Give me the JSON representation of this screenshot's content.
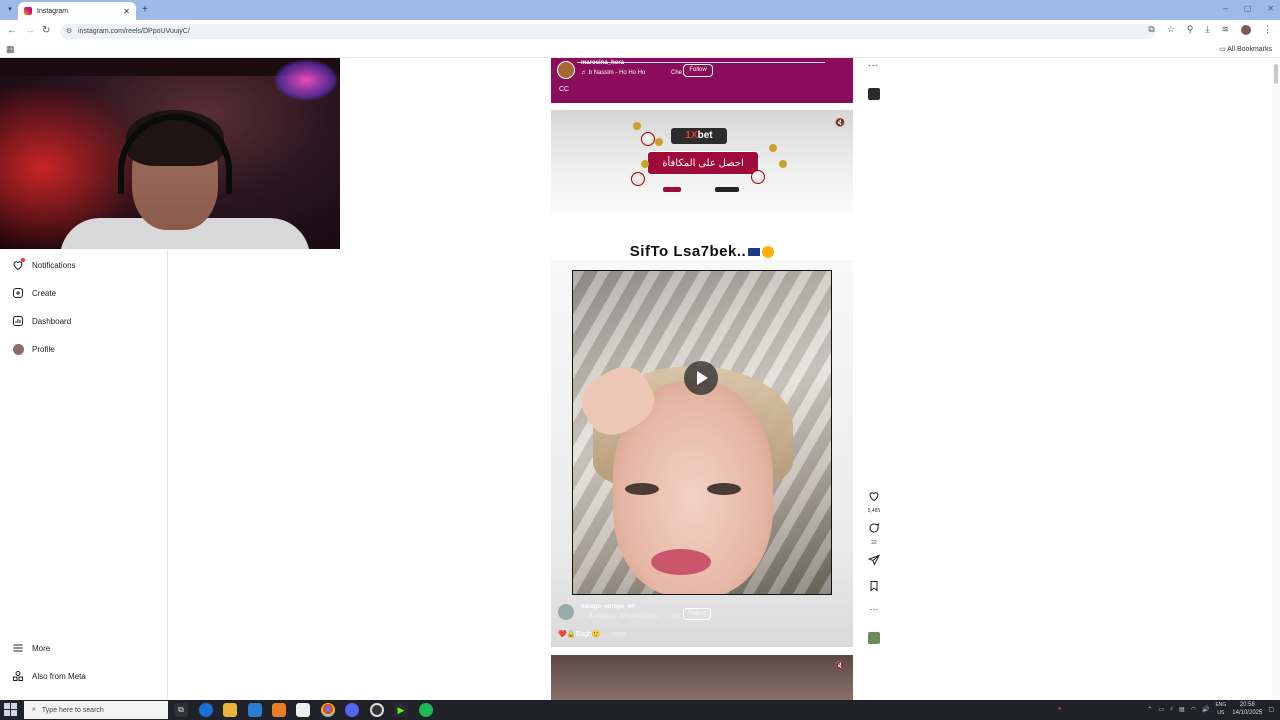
{
  "browser": {
    "tab_title": "Instagram",
    "url": "instagram.com/reels/DPpoUVuuiyC/",
    "all_bookmarks": "All Bookmarks"
  },
  "sidebar": {
    "items": [
      {
        "label": "Notifications",
        "icon": "heart-icon"
      },
      {
        "label": "Create",
        "icon": "plus-square-icon"
      },
      {
        "label": "Dashboard",
        "icon": "chart-icon"
      },
      {
        "label": "Profile",
        "icon": "avatar-icon"
      },
      {
        "label": "More",
        "icon": "menu-icon"
      },
      {
        "label": "Also from Meta",
        "icon": "meta-icon"
      }
    ]
  },
  "feed": {
    "post1": {
      "username": "marocina_hora",
      "audio": "♬ b Nassim - Ho Ho Ho",
      "extra": "Che",
      "follow_label": "Follow",
      "cc": "CC"
    },
    "ad": {
      "brand_prefix": "1X",
      "brand_suffix": "bet",
      "banner_text": "احصل على المكافأة"
    },
    "reel": {
      "caption": "SifTo Lsa7bek..",
      "username": "harago_europe_44",
      "audio": "♬ Ballagena · Original audio",
      "mini": "Mix",
      "follow_label": "Follow",
      "description": "❤️🔒Bagh🙂...",
      "more": "more",
      "likes": "5,485",
      "comments": "22"
    }
  },
  "taskbar": {
    "search_placeholder": "Type here to search",
    "lang": "ENG",
    "region": "US",
    "time": "20:58",
    "date": "14/10/2025"
  },
  "colors": {
    "post1_bg": "#8b0b5c",
    "ad_banner": "#a00a3a",
    "taskbar": "#1f2228",
    "tabbar": "#9db9e8"
  }
}
